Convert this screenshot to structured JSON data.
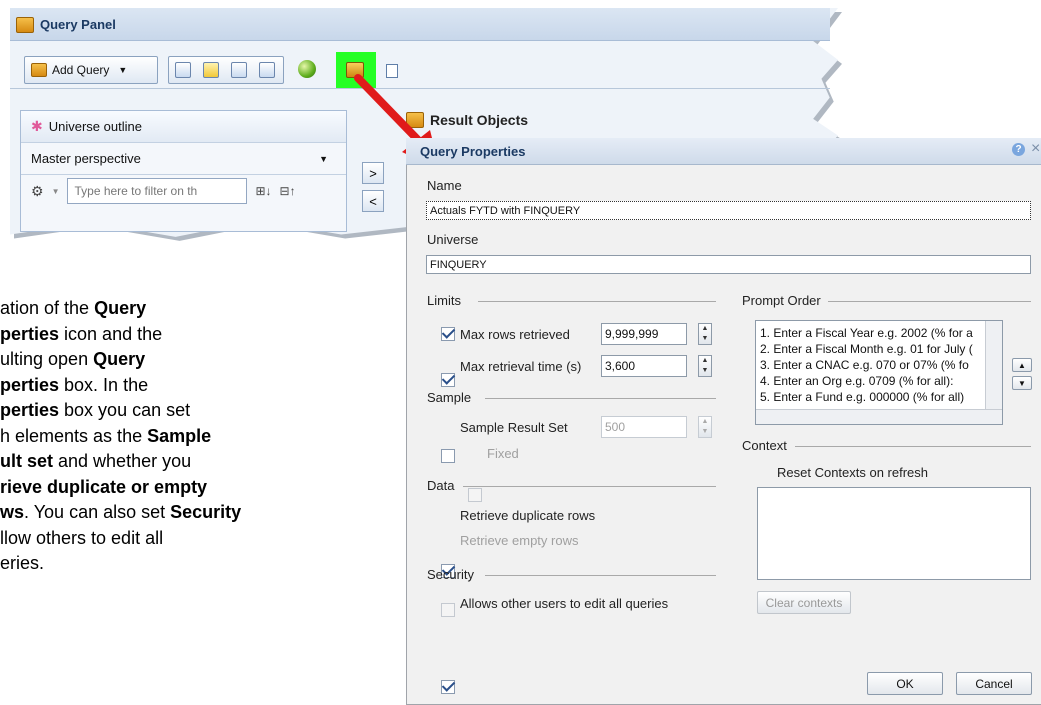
{
  "query_panel": {
    "title": "Query Panel",
    "add_query_label": "Add Query",
    "universe_outline_label": "Universe outline",
    "perspective_value": "Master perspective",
    "filter_placeholder": "Type here to filter on th",
    "result_objects_label": "Result Objects",
    "add_arrow": ">",
    "remove_arrow": "<"
  },
  "explanation": {
    "line1_a": "ation of the ",
    "line1_b": "Query",
    "line2_a": "perties",
    "line2_b": " icon and the",
    "line3_a": "ulting open ",
    "line3_b": "Query",
    "line4_a": "perties",
    "line4_b": " box. In the",
    "line5_a": "perties",
    "line5_b": " box you can set",
    "line6_a": "h elements as the ",
    "line6_b": "Sample",
    "line7_a": "ult set",
    "line7_b": " and whether you",
    "line8_a": "rieve duplicate or empty",
    "line9_a": "ws",
    "line9_b": ". You can also set ",
    "line9_c": "Security",
    "line10_a": "llow others to edit all",
    "line11_a": "eries."
  },
  "dialog": {
    "title": "Query Properties",
    "help_icon": "?",
    "close_icon": "×",
    "name_label": "Name",
    "name_value": "Actuals FYTD with FINQUERY",
    "universe_label": "Universe",
    "universe_value": "FINQUERY",
    "limits_label": "Limits",
    "max_rows_label": "Max rows retrieved",
    "max_rows_value": "9,999,999",
    "max_time_label": "Max retrieval time (s)",
    "max_time_value": "3,600",
    "sample_label": "Sample",
    "sample_result_label": "Sample Result Set",
    "sample_value": "500",
    "fixed_label": "Fixed",
    "data_label": "Data",
    "retrieve_dup_label": "Retrieve duplicate rows",
    "retrieve_empty_label": "Retrieve empty rows",
    "security_label": "Security",
    "allow_edit_label": "Allows other users to edit all queries",
    "prompt_order_label": "Prompt Order",
    "prompts": [
      "1. Enter a Fiscal Year e.g. 2002 (% for a",
      "2. Enter a Fiscal Month e.g. 01 for July (",
      "3. Enter a CNAC e.g. 070 or 07% (% fo",
      "4. Enter an Org e.g. 0709 (% for all):",
      "5. Enter a Fund e.g. 000000 (% for all)"
    ],
    "context_label": "Context",
    "reset_contexts_label": "Reset Contexts on refresh",
    "clear_contexts_label": "Clear contexts",
    "ok_label": "OK",
    "cancel_label": "Cancel"
  },
  "colors": {
    "highlight": "#25ff25",
    "arrow": "#e01b1b"
  }
}
